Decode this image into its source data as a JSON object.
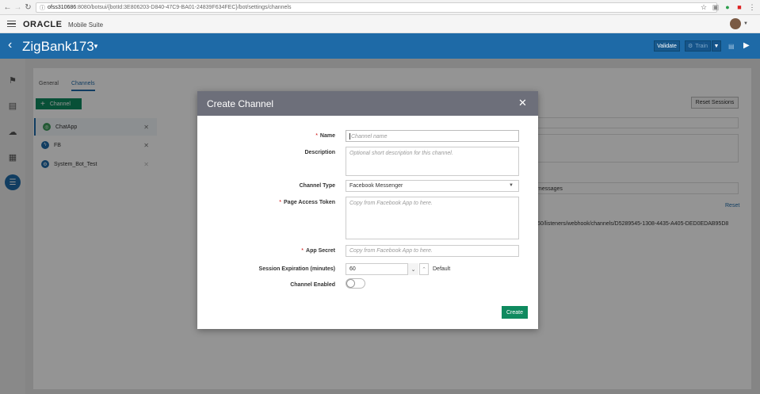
{
  "browser": {
    "url_host": "ofss310686",
    "url_rest": ":8080/botsui/{botId:3E806203-D840-47C9-BA01-24839F634FEC}/bot/settings/channels"
  },
  "app": {
    "logo": "ORACLE",
    "suite": "Mobile Suite"
  },
  "bot_header": {
    "bot_name": "ZigBank173",
    "validate_label": "Validate",
    "train_label": "Train"
  },
  "tabs": [
    {
      "label": "General"
    },
    {
      "label": "Channels"
    }
  ],
  "channels_panel": {
    "add_label": "Channel",
    "items": [
      {
        "name": "ChatApp"
      },
      {
        "name": "FB"
      },
      {
        "name": "System_Bot_Test"
      }
    ],
    "reset_sessions_label": "Reset Sessions",
    "bg_messages_text": "messages",
    "bg_reset_link": "Reset",
    "bg_webhook_text": "60/listeners/webhook/channels/D5289545-1308-4435-A405-DED0EDAB95D8"
  },
  "dialog": {
    "title": "Create Channel",
    "name_label": "Name",
    "name_placeholder": "Channel name",
    "description_label": "Description",
    "description_placeholder": "Optional short description for this channel.",
    "channel_type_label": "Channel Type",
    "channel_type_value": "Facebook Messenger",
    "page_token_label": "Page Access Token",
    "page_token_placeholder": "Copy from Facebook App to here.",
    "app_secret_label": "App Secret",
    "app_secret_placeholder": "Copy from Facebook App to here.",
    "session_label": "Session Expiration (minutes)",
    "session_value": "60",
    "default_label": "Default",
    "enabled_label": "Channel Enabled",
    "enabled": false,
    "create_label": "Create"
  },
  "colors": {
    "brand_blue": "#1e6aa7",
    "primary_green": "#0f8a5f",
    "dialog_header": "#6d6f7a"
  }
}
